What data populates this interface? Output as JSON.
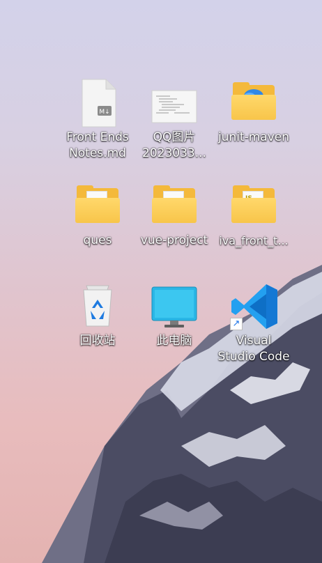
{
  "desktop": {
    "icons": [
      {
        "label": "Front Ends\nNotes.md",
        "icon": "markdown-file-icon"
      },
      {
        "label": "QQ图片\n2023033...",
        "icon": "image-file-icon"
      },
      {
        "label": "junit-maven",
        "icon": "folder-onedrive-icon"
      },
      {
        "label": "ques",
        "icon": "folder-icon"
      },
      {
        "label": "vue-project",
        "icon": "folder-icon"
      },
      {
        "label": "iva_front_t...",
        "icon": "folder-js-icon"
      },
      {
        "label": "回收站",
        "icon": "recycle-bin-icon"
      },
      {
        "label": "此电脑",
        "icon": "computer-icon"
      },
      {
        "label": "Visual\nStudio Code",
        "icon": "vscode-shortcut-icon"
      }
    ],
    "md_badge": "M↓",
    "js_badge": "JS",
    "colors": {
      "folder": "#f4b93b",
      "vscode": "#23a0f0",
      "monitor": "#2ab6e6"
    }
  }
}
